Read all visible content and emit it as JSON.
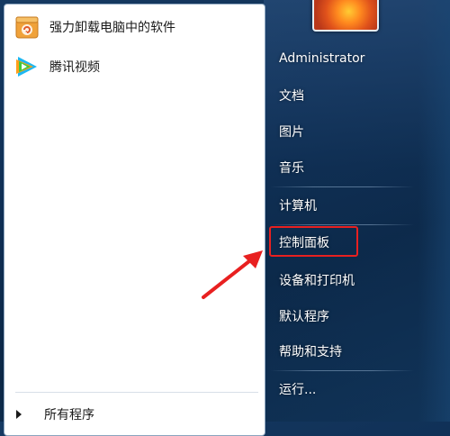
{
  "left_panel": {
    "programs": [
      {
        "label": "强力卸载电脑中的软件",
        "icon": "uninstaller-box-icon"
      },
      {
        "label": "腾讯视频",
        "icon": "tencent-video-play-icon"
      }
    ],
    "all_programs_label": "所有程序"
  },
  "right_panel": {
    "user_name": "Administrator",
    "items": [
      {
        "label": "文档"
      },
      {
        "label": "图片"
      },
      {
        "label": "音乐"
      },
      {
        "label": "计算机"
      },
      {
        "label": "控制面板",
        "highlighted": true
      },
      {
        "label": "设备和打印机"
      },
      {
        "label": "默认程序"
      },
      {
        "label": "帮助和支持"
      },
      {
        "label": "运行..."
      }
    ]
  },
  "annotation": {
    "highlight_color": "#e82020",
    "arrow_icon": "red-pointer-arrow-icon"
  }
}
